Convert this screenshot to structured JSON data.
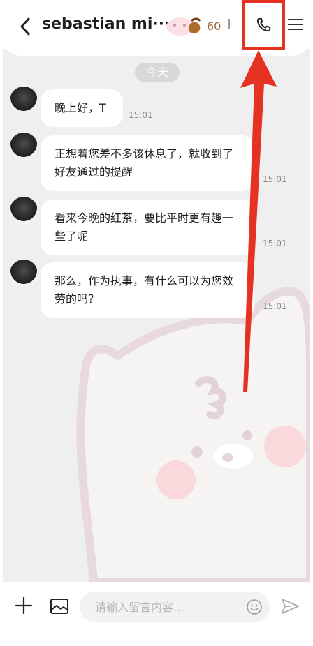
{
  "header": {
    "back_icon": "chevron-left-icon",
    "title": "sebastian mi···",
    "coin_count": "60",
    "plus_label": "+",
    "call_icon": "phone-icon",
    "menu_icon": "hamburger-menu-icon"
  },
  "chat": {
    "date_label": "今天",
    "messages": [
      {
        "text": "晚上好，T",
        "time": "15:01"
      },
      {
        "text": "正想着您差不多该休息了，就收到了好友通过的提醒",
        "time": "15:01"
      },
      {
        "text": "看来今晚的红茶，要比平时更有趣一些了呢",
        "time": "15:01"
      },
      {
        "text": "那么，作为执事，有什么可以为您效劳的吗？",
        "time": "15:01"
      }
    ]
  },
  "input_bar": {
    "placeholder": "请输入留言内容...",
    "plus_icon": "plus-icon",
    "image_icon": "image-icon",
    "emoji_icon": "smiley-icon",
    "send_icon": "send-icon"
  },
  "colors": {
    "annotation_red": "#e63222",
    "chat_bg": "#f0efef",
    "bubble_bg": "#ffffff",
    "date_pill": "#d9d8d8"
  }
}
